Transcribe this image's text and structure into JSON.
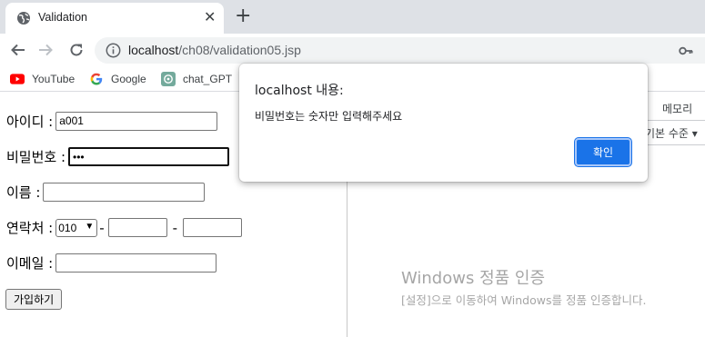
{
  "browser": {
    "tab_title": "Validation",
    "url_host": "localhost",
    "url_path": "/ch08/validation05.jsp",
    "bookmarks": [
      {
        "label": "YouTube",
        "icon": "youtube-icon"
      },
      {
        "label": "Google",
        "icon": "google-icon"
      },
      {
        "label": "chat_GPT",
        "icon": "chatgpt-icon"
      }
    ]
  },
  "form": {
    "id_label": "아이디 :",
    "id_value": "a001",
    "password_label": "비밀번호 :",
    "password_value": "•••",
    "name_label": "이름 :",
    "phone_label": "연락처 :",
    "phone_prefix": "010",
    "phone_sep1": "-",
    "phone_sep2": "-",
    "email_label": "이메일 :",
    "submit_label": "가입하기"
  },
  "devtools": {
    "memory_tab": "메모리",
    "level_label": "기본 수준 ▾"
  },
  "activation": {
    "line1": "Windows 정품 인증",
    "line2": "[설정]으로 이동하여 Windows를 정품 인증합니다."
  },
  "alert": {
    "title": "localhost 내용:",
    "message": "비밀번호는 숫자만 입력해주세요",
    "ok_label": "확인"
  },
  "colors": {
    "accent": "#1a73e8",
    "tabstrip": "#dee1e6"
  }
}
